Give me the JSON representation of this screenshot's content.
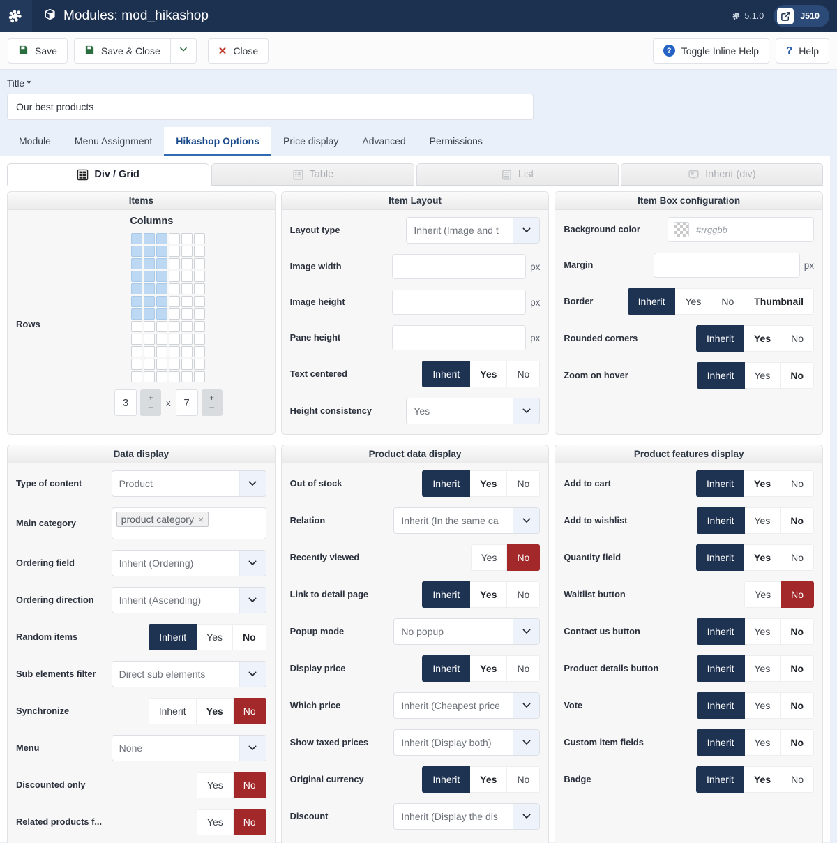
{
  "header": {
    "logo_icon": "joomla-logo-icon",
    "box_icon": "box-icon",
    "title": "Modules: mod_hikashop",
    "version": "5.1.0",
    "session_badge": "J510",
    "external_icon": "external-link-icon"
  },
  "toolbar": {
    "save": "Save",
    "save_close": "Save & Close",
    "dropdown_icon": "chevron-down-icon",
    "close": "Close",
    "toggle_inline_help": "Toggle Inline Help",
    "help": "Help"
  },
  "title_field": {
    "label": "Title *",
    "value": "Our best products"
  },
  "main_tabs": [
    {
      "label": "Module",
      "active": false
    },
    {
      "label": "Menu Assignment",
      "active": false
    },
    {
      "label": "Hikashop Options",
      "active": true
    },
    {
      "label": "Price display",
      "active": false
    },
    {
      "label": "Advanced",
      "active": false
    },
    {
      "label": "Permissions",
      "active": false
    }
  ],
  "sub_tabs": [
    {
      "label": "Div / Grid",
      "icon": "grid-icon",
      "active": true
    },
    {
      "label": "Table",
      "icon": "table-icon",
      "active": false
    },
    {
      "label": "List",
      "icon": "list-icon",
      "active": false
    },
    {
      "label": "Inherit (div)",
      "icon": "inherit-icon",
      "active": false
    }
  ],
  "items_panel": {
    "title": "Items",
    "columns_label": "Columns",
    "rows_label": "Rows",
    "grid_cols": 6,
    "grid_rows": 12,
    "selected_cols": 3,
    "selected_rows": 7,
    "cols_value": "3",
    "rows_value": "7",
    "separator": "x",
    "plus": "+",
    "minus": "–"
  },
  "item_layout": {
    "title": "Item Layout",
    "rows": [
      {
        "label": "Layout type",
        "type": "select",
        "value": "Inherit (Image and t"
      },
      {
        "label": "Image width",
        "type": "text",
        "value": "",
        "unit": "px"
      },
      {
        "label": "Image height",
        "type": "text",
        "value": "",
        "unit": "px"
      },
      {
        "label": "Pane height",
        "type": "text",
        "value": "",
        "unit": "px"
      },
      {
        "label": "Text centered",
        "type": "buttons",
        "options": [
          {
            "label": "Inherit",
            "state": "dark"
          },
          {
            "label": "Yes",
            "state": "bold"
          },
          {
            "label": "No",
            "state": "plain"
          }
        ]
      },
      {
        "label": "Height consistency",
        "type": "select",
        "value": "Yes"
      }
    ]
  },
  "item_box": {
    "title": "Item Box configuration",
    "rows": [
      {
        "label": "Background color",
        "type": "color",
        "placeholder": "#rrggbb",
        "icon": "color-swatch-icon"
      },
      {
        "label": "Margin",
        "type": "text",
        "value": "",
        "unit": "px"
      },
      {
        "label": "Border",
        "type": "buttons",
        "options": [
          {
            "label": "Inherit",
            "state": "dark"
          },
          {
            "label": "Yes",
            "state": "plain"
          },
          {
            "label": "No",
            "state": "plain"
          },
          {
            "label": "Thumbnail",
            "state": "bold"
          }
        ]
      },
      {
        "label": "Rounded corners",
        "type": "buttons",
        "options": [
          {
            "label": "Inherit",
            "state": "dark"
          },
          {
            "label": "Yes",
            "state": "bold"
          },
          {
            "label": "No",
            "state": "plain"
          }
        ]
      },
      {
        "label": "Zoom on hover",
        "type": "buttons",
        "options": [
          {
            "label": "Inherit",
            "state": "dark"
          },
          {
            "label": "Yes",
            "state": "plain"
          },
          {
            "label": "No",
            "state": "bold"
          }
        ]
      }
    ]
  },
  "data_display": {
    "title": "Data display",
    "rows": [
      {
        "label": "Type of content",
        "type": "select",
        "value": "Product"
      },
      {
        "label": "Main category",
        "type": "tag",
        "tag": "product category",
        "remove_icon": "remove-tag-icon"
      },
      {
        "label": "Ordering field",
        "type": "select",
        "value": "Inherit (Ordering)"
      },
      {
        "label": "Ordering direction",
        "type": "select",
        "value": "Inherit (Ascending)"
      },
      {
        "label": "Random items",
        "type": "buttons",
        "options": [
          {
            "label": "Inherit",
            "state": "dark"
          },
          {
            "label": "Yes",
            "state": "plain"
          },
          {
            "label": "No",
            "state": "bold"
          }
        ]
      },
      {
        "label": "Sub elements filter",
        "type": "select",
        "value": "Direct sub elements"
      },
      {
        "label": "Synchronize",
        "type": "buttons",
        "options": [
          {
            "label": "Inherit",
            "state": "plain"
          },
          {
            "label": "Yes",
            "state": "bold"
          },
          {
            "label": "No",
            "state": "red"
          }
        ]
      },
      {
        "label": "Menu",
        "type": "select",
        "value": "None"
      },
      {
        "label": "Discounted only",
        "type": "buttons",
        "options": [
          {
            "label": "Yes",
            "state": "plain"
          },
          {
            "label": "No",
            "state": "red"
          }
        ]
      },
      {
        "label": "Related products f...",
        "type": "buttons",
        "options": [
          {
            "label": "Yes",
            "state": "plain"
          },
          {
            "label": "No",
            "state": "red"
          }
        ]
      }
    ]
  },
  "product_data_display": {
    "title": "Product data display",
    "rows": [
      {
        "label": "Out of stock",
        "type": "buttons",
        "options": [
          {
            "label": "Inherit",
            "state": "dark"
          },
          {
            "label": "Yes",
            "state": "bold"
          },
          {
            "label": "No",
            "state": "plain"
          }
        ]
      },
      {
        "label": "Relation",
        "type": "select",
        "value": "Inherit (In the same ca"
      },
      {
        "label": "Recently viewed",
        "type": "buttons",
        "options": [
          {
            "label": "Yes",
            "state": "plain"
          },
          {
            "label": "No",
            "state": "red"
          }
        ]
      },
      {
        "label": "Link to detail page",
        "type": "buttons",
        "options": [
          {
            "label": "Inherit",
            "state": "dark"
          },
          {
            "label": "Yes",
            "state": "bold"
          },
          {
            "label": "No",
            "state": "plain"
          }
        ]
      },
      {
        "label": "Popup mode",
        "type": "select",
        "value": "No popup"
      },
      {
        "label": "Display price",
        "type": "buttons",
        "options": [
          {
            "label": "Inherit",
            "state": "dark"
          },
          {
            "label": "Yes",
            "state": "bold"
          },
          {
            "label": "No",
            "state": "plain"
          }
        ]
      },
      {
        "label": "Which price",
        "type": "select",
        "value": "Inherit (Cheapest price"
      },
      {
        "label": "Show taxed prices",
        "type": "select",
        "value": "Inherit (Display both)"
      },
      {
        "label": "Original currency",
        "type": "buttons",
        "options": [
          {
            "label": "Inherit",
            "state": "dark"
          },
          {
            "label": "Yes",
            "state": "bold"
          },
          {
            "label": "No",
            "state": "plain"
          }
        ]
      },
      {
        "label": "Discount",
        "type": "select",
        "value": "Inherit (Display the dis"
      }
    ]
  },
  "product_features_display": {
    "title": "Product features display",
    "rows": [
      {
        "label": "Add to cart",
        "type": "buttons",
        "options": [
          {
            "label": "Inherit",
            "state": "dark"
          },
          {
            "label": "Yes",
            "state": "bold"
          },
          {
            "label": "No",
            "state": "plain"
          }
        ]
      },
      {
        "label": "Add to wishlist",
        "type": "buttons",
        "options": [
          {
            "label": "Inherit",
            "state": "dark"
          },
          {
            "label": "Yes",
            "state": "plain"
          },
          {
            "label": "No",
            "state": "bold"
          }
        ]
      },
      {
        "label": "Quantity field",
        "type": "buttons",
        "options": [
          {
            "label": "Inherit",
            "state": "dark"
          },
          {
            "label": "Yes",
            "state": "bold"
          },
          {
            "label": "No",
            "state": "plain"
          }
        ]
      },
      {
        "label": "Waitlist button",
        "type": "buttons",
        "options": [
          {
            "label": "Yes",
            "state": "plain"
          },
          {
            "label": "No",
            "state": "red"
          }
        ]
      },
      {
        "label": "Contact us button",
        "type": "buttons",
        "options": [
          {
            "label": "Inherit",
            "state": "dark"
          },
          {
            "label": "Yes",
            "state": "plain"
          },
          {
            "label": "No",
            "state": "bold"
          }
        ]
      },
      {
        "label": "Product details button",
        "type": "buttons",
        "options": [
          {
            "label": "Inherit",
            "state": "dark"
          },
          {
            "label": "Yes",
            "state": "plain"
          },
          {
            "label": "No",
            "state": "bold"
          }
        ]
      },
      {
        "label": "Vote",
        "type": "buttons",
        "options": [
          {
            "label": "Inherit",
            "state": "dark"
          },
          {
            "label": "Yes",
            "state": "plain"
          },
          {
            "label": "No",
            "state": "bold"
          }
        ]
      },
      {
        "label": "Custom item fields",
        "type": "buttons",
        "options": [
          {
            "label": "Inherit",
            "state": "dark"
          },
          {
            "label": "Yes",
            "state": "plain"
          },
          {
            "label": "No",
            "state": "bold"
          }
        ]
      },
      {
        "label": "Badge",
        "type": "buttons",
        "options": [
          {
            "label": "Inherit",
            "state": "dark"
          },
          {
            "label": "Yes",
            "state": "bold"
          },
          {
            "label": "No",
            "state": "plain"
          }
        ]
      }
    ]
  },
  "colors": {
    "header_bg": "#1c3050",
    "selected_dark": "#1e3252",
    "selected_red": "#a2282a",
    "grid_selected": "#bcd8f2",
    "active_tab": "#1a4a8a",
    "page_bg": "#eaf0fa"
  }
}
